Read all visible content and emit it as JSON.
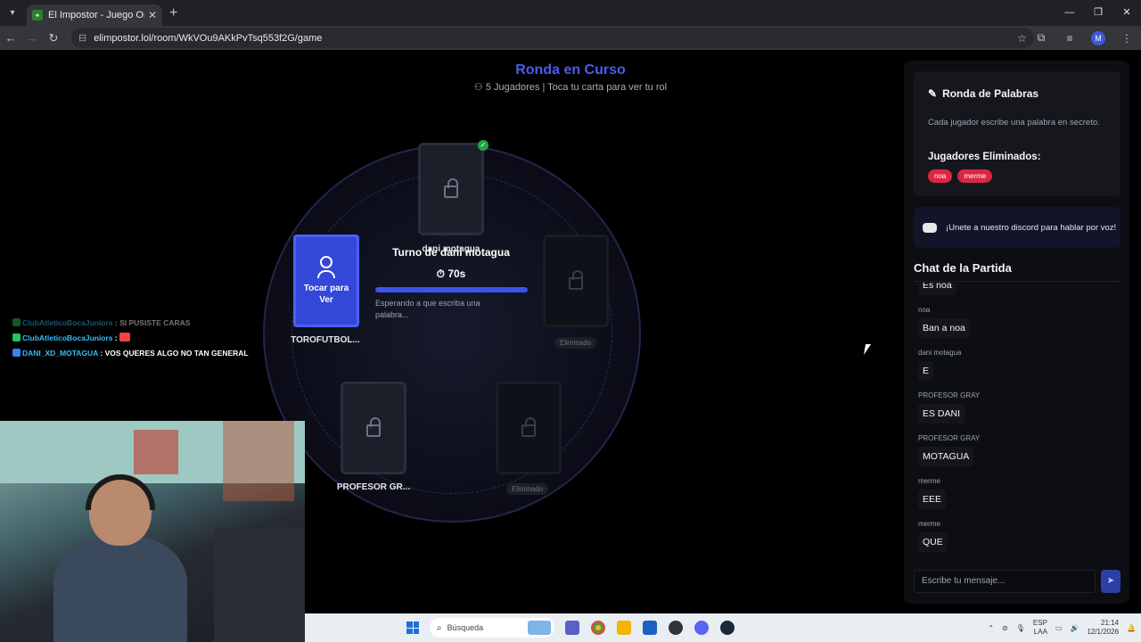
{
  "browser": {
    "tab_title": "El Impostor - Juego Online Gra",
    "url": "elimpostor.lol/room/WkVOu9AKkPvTsq553f2G/game",
    "avatar_letter": "M"
  },
  "game": {
    "title": "Ronda en Curso",
    "subtitle": "5 Jugadores | Toca tu carta para ver tu rol",
    "players": [
      {
        "name": "dani motagua",
        "status": "locked",
        "checked": true
      },
      {
        "name": "TOROFUTBOL...",
        "status": "mine",
        "card_label": "Tocar para Ver"
      },
      {
        "name": "",
        "status": "eliminated",
        "label": "Eliminado"
      },
      {
        "name": "PROFESOR GR...",
        "status": "locked"
      },
      {
        "name": "",
        "status": "eliminated",
        "label": "Eliminado"
      }
    ],
    "turn_text": "Turno de dani motagua",
    "timer": "70s",
    "progress": 1.0,
    "waiting_text": "Esperando a que escriba una palabra..."
  },
  "overlay_chat": [
    {
      "user": "ClubAtleticoBocaJuniors",
      "sep": " : ",
      "msg": "SI PUSISTE CARAS",
      "faded": true
    },
    {
      "user": "ClubAtleticoBocaJuniors",
      "sep": " : ",
      "msg": "",
      "faded": false
    },
    {
      "user": "DANI_XD_MOTAGUA",
      "sep": " : ",
      "msg": "VOS QUERES ALGO NO TAN GENERAL",
      "faded": false
    }
  ],
  "panel": {
    "words_title": "Ronda de Palabras",
    "words_desc": "Cada jugador escribe una palabra en secreto.",
    "eliminated_title": "Jugadores Eliminados:",
    "eliminated": [
      "noa",
      "merme"
    ],
    "discord_text": "¡Unete a nuestro discord para hablar por voz!",
    "chat_title": "Chat de la Partida",
    "messages": [
      {
        "author": "",
        "text": "Es noa"
      },
      {
        "author": "noa",
        "text": "Ban a noa"
      },
      {
        "author": "dani motagua",
        "text": "E"
      },
      {
        "author": "PROFESOR GRAY",
        "text": "ES DANI"
      },
      {
        "author": "PROFESOR GRAY",
        "text": "MOTAGUA"
      },
      {
        "author": "merme",
        "text": "EEE"
      },
      {
        "author": "merme",
        "text": "QUE"
      }
    ],
    "input_placeholder": "Escribe tu mensaje..."
  },
  "taskbar": {
    "search_placeholder": "Búsqueda",
    "lang1": "ESP",
    "lang2": "LAA",
    "time": "21:14",
    "date": "12/1/2026"
  },
  "colors": {
    "accent": "#4c5bf0",
    "eliminated_tag": "#dc2644",
    "progress": "#3b55e6"
  }
}
